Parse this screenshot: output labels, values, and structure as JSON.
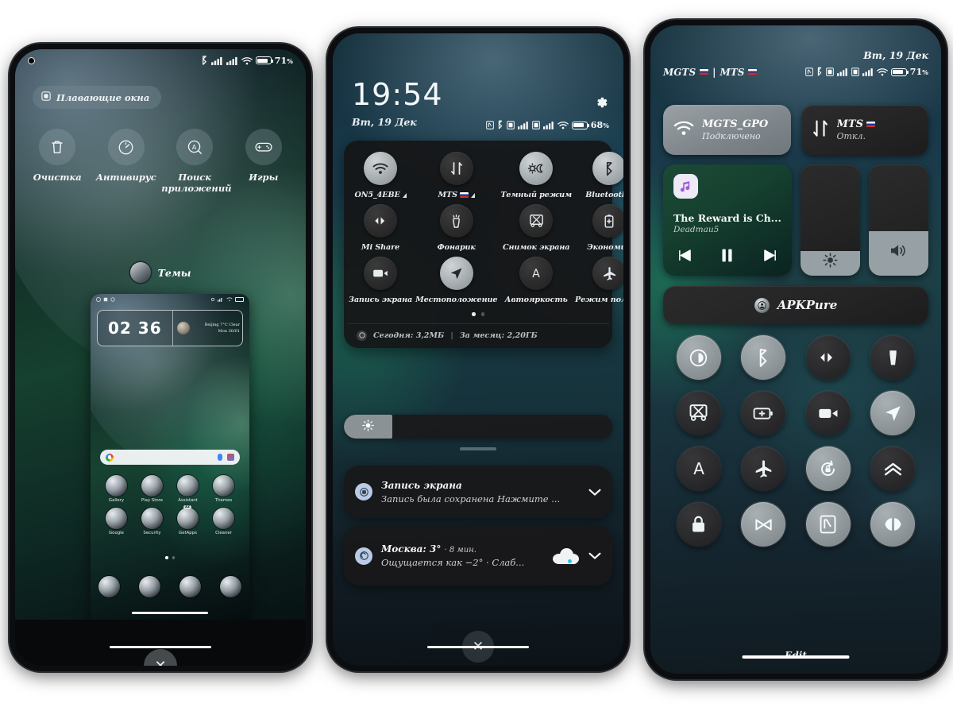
{
  "panel1": {
    "statusbar": {
      "battery_pct": "71",
      "icons": [
        "camera-punch-hole",
        "bluetooth-icon",
        "signal-bars-icon",
        "signal-bars-icon",
        "wifi-icon",
        "battery-icon"
      ]
    },
    "floating_windows_chip": "Плавающие окна",
    "shortcuts": [
      {
        "label": "Очистка",
        "icon": "trash-icon"
      },
      {
        "label": "Антивирус",
        "icon": "speedometer-icon"
      },
      {
        "label": "Поиск приложений",
        "icon": "app-search-icon"
      },
      {
        "label": "Игры",
        "icon": "gamepad-icon"
      }
    ],
    "recent_app": {
      "label": "Темы",
      "icon": "themes-icon"
    },
    "preview": {
      "clock": "02 36",
      "weather_line1": "Beijing 7°C Clear",
      "weather_line2": "Mon 30/01",
      "apps_row1": [
        "Gallery",
        "Play Store",
        "Assistant",
        "Themes"
      ],
      "apps_row2": [
        "Google",
        "Security",
        "GetApps",
        "Cleaner"
      ],
      "getapps_badge": "32",
      "page_dots": 2,
      "active_dot": 0
    },
    "close_button": "✕"
  },
  "panel2": {
    "time": "19:54",
    "date": "Вт, 19 Дек",
    "battery_pct": "68",
    "gear_icon": "settings-gear-icon",
    "quick_settings": [
      {
        "label": "ON5_4EBE",
        "icon": "wifi-icon",
        "on": true,
        "caret": true,
        "flag": false
      },
      {
        "label": "MTS",
        "icon": "mobile-data-icon",
        "on": false,
        "caret": true,
        "flag": true
      },
      {
        "label": "Темный режим",
        "icon": "dark-mode-icon",
        "on": true,
        "caret": false,
        "flag": false
      },
      {
        "label": "Bluetooth",
        "icon": "bluetooth-icon",
        "on": true,
        "caret": true,
        "flag": false
      },
      {
        "label": "Mi Share",
        "icon": "mi-share-icon",
        "on": false,
        "caret": false,
        "flag": false
      },
      {
        "label": "Фонарик",
        "icon": "flashlight-icon",
        "on": false,
        "caret": false,
        "flag": false
      },
      {
        "label": "Снимок экрана",
        "icon": "screenshot-icon",
        "on": false,
        "caret": false,
        "flag": false
      },
      {
        "label": "Экономия",
        "icon": "battery-saver-icon",
        "on": false,
        "caret": false,
        "flag": false
      },
      {
        "label": "Запись экрана",
        "icon": "screen-record-icon",
        "on": false,
        "caret": false,
        "flag": false
      },
      {
        "label": "Местоположение",
        "icon": "location-icon",
        "on": true,
        "caret": false,
        "flag": false
      },
      {
        "label": "Автояркость",
        "icon": "auto-brightness-icon",
        "on": false,
        "caret": false,
        "flag": false
      },
      {
        "label": "Режим полета",
        "icon": "airplane-icon",
        "on": false,
        "caret": false,
        "flag": false
      }
    ],
    "qs_pages": 2,
    "qs_active_page": 0,
    "data_usage": {
      "today_label": "Сегодня: 3,2МБ",
      "month_label": "За месяц: 2,20ГБ",
      "separator": "|"
    },
    "brightness_percent": 18,
    "notifications": [
      {
        "title": "Запись экрана",
        "subtitle": "Запись была сохранена Нажмите ...",
        "icon": "screen-record-icon",
        "chevron": "chevron-down-icon"
      },
      {
        "title": "Москва: 3°",
        "time": "· 8 мин.",
        "subtitle": "Ощущается как −2° · Слаб...",
        "icon": "weather-icon",
        "chevron": "chevron-down-icon",
        "art": "cloud-icon"
      }
    ],
    "close_button": "✕"
  },
  "panel3": {
    "date": "Вт, 19 Дек",
    "carrier1": "MGTS",
    "carrier_separator": "|",
    "carrier2": "MTS",
    "battery_pct": "71",
    "connectivity": [
      {
        "title": "MGTS_GPO",
        "subtitle": "Подключено",
        "icon": "wifi-icon",
        "on": true
      },
      {
        "title": "MTS",
        "subtitle": "Откл.",
        "icon": "mobile-data-icon",
        "on": false,
        "flag": true
      }
    ],
    "media": {
      "track": "The Reward is Ch...",
      "artist": "Deadmau5",
      "art_icon": "music-note-icon",
      "prev_icon": "skip-previous-icon",
      "play_icon": "pause-icon",
      "next_icon": "skip-next-icon"
    },
    "brightness_percent": 22,
    "volume_percent": 40,
    "brightness_icon": "brightness-icon",
    "volume_icon": "volume-icon",
    "app_shortcut": {
      "label": "APKPure",
      "icon": "apkpure-icon"
    },
    "toggles": [
      {
        "icon": "dark-mode-contrast-icon",
        "on": true
      },
      {
        "icon": "bluetooth-icon",
        "on": true
      },
      {
        "icon": "mi-share-icon",
        "on": false
      },
      {
        "icon": "flashlight-icon",
        "on": false
      },
      {
        "icon": "screenshot-icon",
        "on": false
      },
      {
        "icon": "battery-saver-icon",
        "on": false
      },
      {
        "icon": "screen-record-icon",
        "on": false
      },
      {
        "icon": "location-icon",
        "on": true
      },
      {
        "icon": "auto-brightness-icon",
        "on": false
      },
      {
        "icon": "airplane-icon",
        "on": false
      },
      {
        "icon": "rotation-lock-icon",
        "on": true
      },
      {
        "icon": "boost-icon",
        "on": false
      },
      {
        "icon": "lock-icon",
        "on": false
      },
      {
        "icon": "cast-off-icon",
        "on": true
      },
      {
        "icon": "nfc-icon",
        "on": true
      },
      {
        "icon": "reading-mode-icon",
        "on": true
      }
    ],
    "edit_label": "Edit"
  },
  "colors": {
    "accent_blue": "#2ec4ea",
    "panel_dark": "#18181a",
    "tile_on": "#a7aeb1",
    "tile_off": "#2a2a2c",
    "wall_green": "#16402f",
    "wall_teal": "#1a3b45"
  }
}
